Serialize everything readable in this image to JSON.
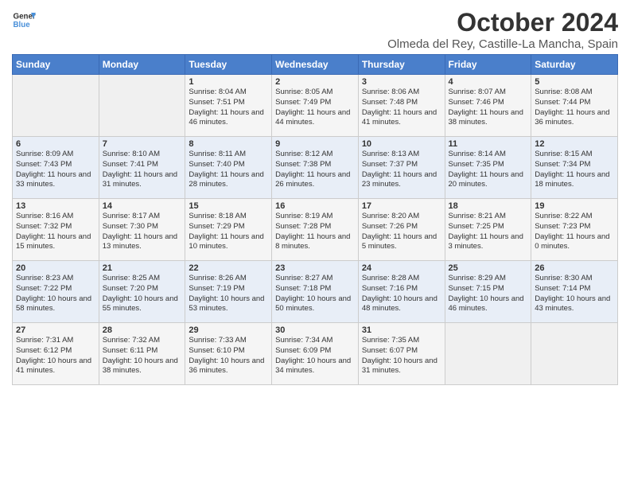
{
  "header": {
    "logo_general": "General",
    "logo_blue": "Blue",
    "month_title": "October 2024",
    "location": "Olmeda del Rey, Castille-La Mancha, Spain"
  },
  "weekdays": [
    "Sunday",
    "Monday",
    "Tuesday",
    "Wednesday",
    "Thursday",
    "Friday",
    "Saturday"
  ],
  "weeks": [
    [
      {
        "day": "",
        "sunrise": "",
        "sunset": "",
        "daylight": ""
      },
      {
        "day": "",
        "sunrise": "",
        "sunset": "",
        "daylight": ""
      },
      {
        "day": "1",
        "sunrise": "Sunrise: 8:04 AM",
        "sunset": "Sunset: 7:51 PM",
        "daylight": "Daylight: 11 hours and 46 minutes."
      },
      {
        "day": "2",
        "sunrise": "Sunrise: 8:05 AM",
        "sunset": "Sunset: 7:49 PM",
        "daylight": "Daylight: 11 hours and 44 minutes."
      },
      {
        "day": "3",
        "sunrise": "Sunrise: 8:06 AM",
        "sunset": "Sunset: 7:48 PM",
        "daylight": "Daylight: 11 hours and 41 minutes."
      },
      {
        "day": "4",
        "sunrise": "Sunrise: 8:07 AM",
        "sunset": "Sunset: 7:46 PM",
        "daylight": "Daylight: 11 hours and 38 minutes."
      },
      {
        "day": "5",
        "sunrise": "Sunrise: 8:08 AM",
        "sunset": "Sunset: 7:44 PM",
        "daylight": "Daylight: 11 hours and 36 minutes."
      }
    ],
    [
      {
        "day": "6",
        "sunrise": "Sunrise: 8:09 AM",
        "sunset": "Sunset: 7:43 PM",
        "daylight": "Daylight: 11 hours and 33 minutes."
      },
      {
        "day": "7",
        "sunrise": "Sunrise: 8:10 AM",
        "sunset": "Sunset: 7:41 PM",
        "daylight": "Daylight: 11 hours and 31 minutes."
      },
      {
        "day": "8",
        "sunrise": "Sunrise: 8:11 AM",
        "sunset": "Sunset: 7:40 PM",
        "daylight": "Daylight: 11 hours and 28 minutes."
      },
      {
        "day": "9",
        "sunrise": "Sunrise: 8:12 AM",
        "sunset": "Sunset: 7:38 PM",
        "daylight": "Daylight: 11 hours and 26 minutes."
      },
      {
        "day": "10",
        "sunrise": "Sunrise: 8:13 AM",
        "sunset": "Sunset: 7:37 PM",
        "daylight": "Daylight: 11 hours and 23 minutes."
      },
      {
        "day": "11",
        "sunrise": "Sunrise: 8:14 AM",
        "sunset": "Sunset: 7:35 PM",
        "daylight": "Daylight: 11 hours and 20 minutes."
      },
      {
        "day": "12",
        "sunrise": "Sunrise: 8:15 AM",
        "sunset": "Sunset: 7:34 PM",
        "daylight": "Daylight: 11 hours and 18 minutes."
      }
    ],
    [
      {
        "day": "13",
        "sunrise": "Sunrise: 8:16 AM",
        "sunset": "Sunset: 7:32 PM",
        "daylight": "Daylight: 11 hours and 15 minutes."
      },
      {
        "day": "14",
        "sunrise": "Sunrise: 8:17 AM",
        "sunset": "Sunset: 7:30 PM",
        "daylight": "Daylight: 11 hours and 13 minutes."
      },
      {
        "day": "15",
        "sunrise": "Sunrise: 8:18 AM",
        "sunset": "Sunset: 7:29 PM",
        "daylight": "Daylight: 11 hours and 10 minutes."
      },
      {
        "day": "16",
        "sunrise": "Sunrise: 8:19 AM",
        "sunset": "Sunset: 7:28 PM",
        "daylight": "Daylight: 11 hours and 8 minutes."
      },
      {
        "day": "17",
        "sunrise": "Sunrise: 8:20 AM",
        "sunset": "Sunset: 7:26 PM",
        "daylight": "Daylight: 11 hours and 5 minutes."
      },
      {
        "day": "18",
        "sunrise": "Sunrise: 8:21 AM",
        "sunset": "Sunset: 7:25 PM",
        "daylight": "Daylight: 11 hours and 3 minutes."
      },
      {
        "day": "19",
        "sunrise": "Sunrise: 8:22 AM",
        "sunset": "Sunset: 7:23 PM",
        "daylight": "Daylight: 11 hours and 0 minutes."
      }
    ],
    [
      {
        "day": "20",
        "sunrise": "Sunrise: 8:23 AM",
        "sunset": "Sunset: 7:22 PM",
        "daylight": "Daylight: 10 hours and 58 minutes."
      },
      {
        "day": "21",
        "sunrise": "Sunrise: 8:25 AM",
        "sunset": "Sunset: 7:20 PM",
        "daylight": "Daylight: 10 hours and 55 minutes."
      },
      {
        "day": "22",
        "sunrise": "Sunrise: 8:26 AM",
        "sunset": "Sunset: 7:19 PM",
        "daylight": "Daylight: 10 hours and 53 minutes."
      },
      {
        "day": "23",
        "sunrise": "Sunrise: 8:27 AM",
        "sunset": "Sunset: 7:18 PM",
        "daylight": "Daylight: 10 hours and 50 minutes."
      },
      {
        "day": "24",
        "sunrise": "Sunrise: 8:28 AM",
        "sunset": "Sunset: 7:16 PM",
        "daylight": "Daylight: 10 hours and 48 minutes."
      },
      {
        "day": "25",
        "sunrise": "Sunrise: 8:29 AM",
        "sunset": "Sunset: 7:15 PM",
        "daylight": "Daylight: 10 hours and 46 minutes."
      },
      {
        "day": "26",
        "sunrise": "Sunrise: 8:30 AM",
        "sunset": "Sunset: 7:14 PM",
        "daylight": "Daylight: 10 hours and 43 minutes."
      }
    ],
    [
      {
        "day": "27",
        "sunrise": "Sunrise: 7:31 AM",
        "sunset": "Sunset: 6:12 PM",
        "daylight": "Daylight: 10 hours and 41 minutes."
      },
      {
        "day": "28",
        "sunrise": "Sunrise: 7:32 AM",
        "sunset": "Sunset: 6:11 PM",
        "daylight": "Daylight: 10 hours and 38 minutes."
      },
      {
        "day": "29",
        "sunrise": "Sunrise: 7:33 AM",
        "sunset": "Sunset: 6:10 PM",
        "daylight": "Daylight: 10 hours and 36 minutes."
      },
      {
        "day": "30",
        "sunrise": "Sunrise: 7:34 AM",
        "sunset": "Sunset: 6:09 PM",
        "daylight": "Daylight: 10 hours and 34 minutes."
      },
      {
        "day": "31",
        "sunrise": "Sunrise: 7:35 AM",
        "sunset": "Sunset: 6:07 PM",
        "daylight": "Daylight: 10 hours and 31 minutes."
      },
      {
        "day": "",
        "sunrise": "",
        "sunset": "",
        "daylight": ""
      },
      {
        "day": "",
        "sunrise": "",
        "sunset": "",
        "daylight": ""
      }
    ]
  ]
}
